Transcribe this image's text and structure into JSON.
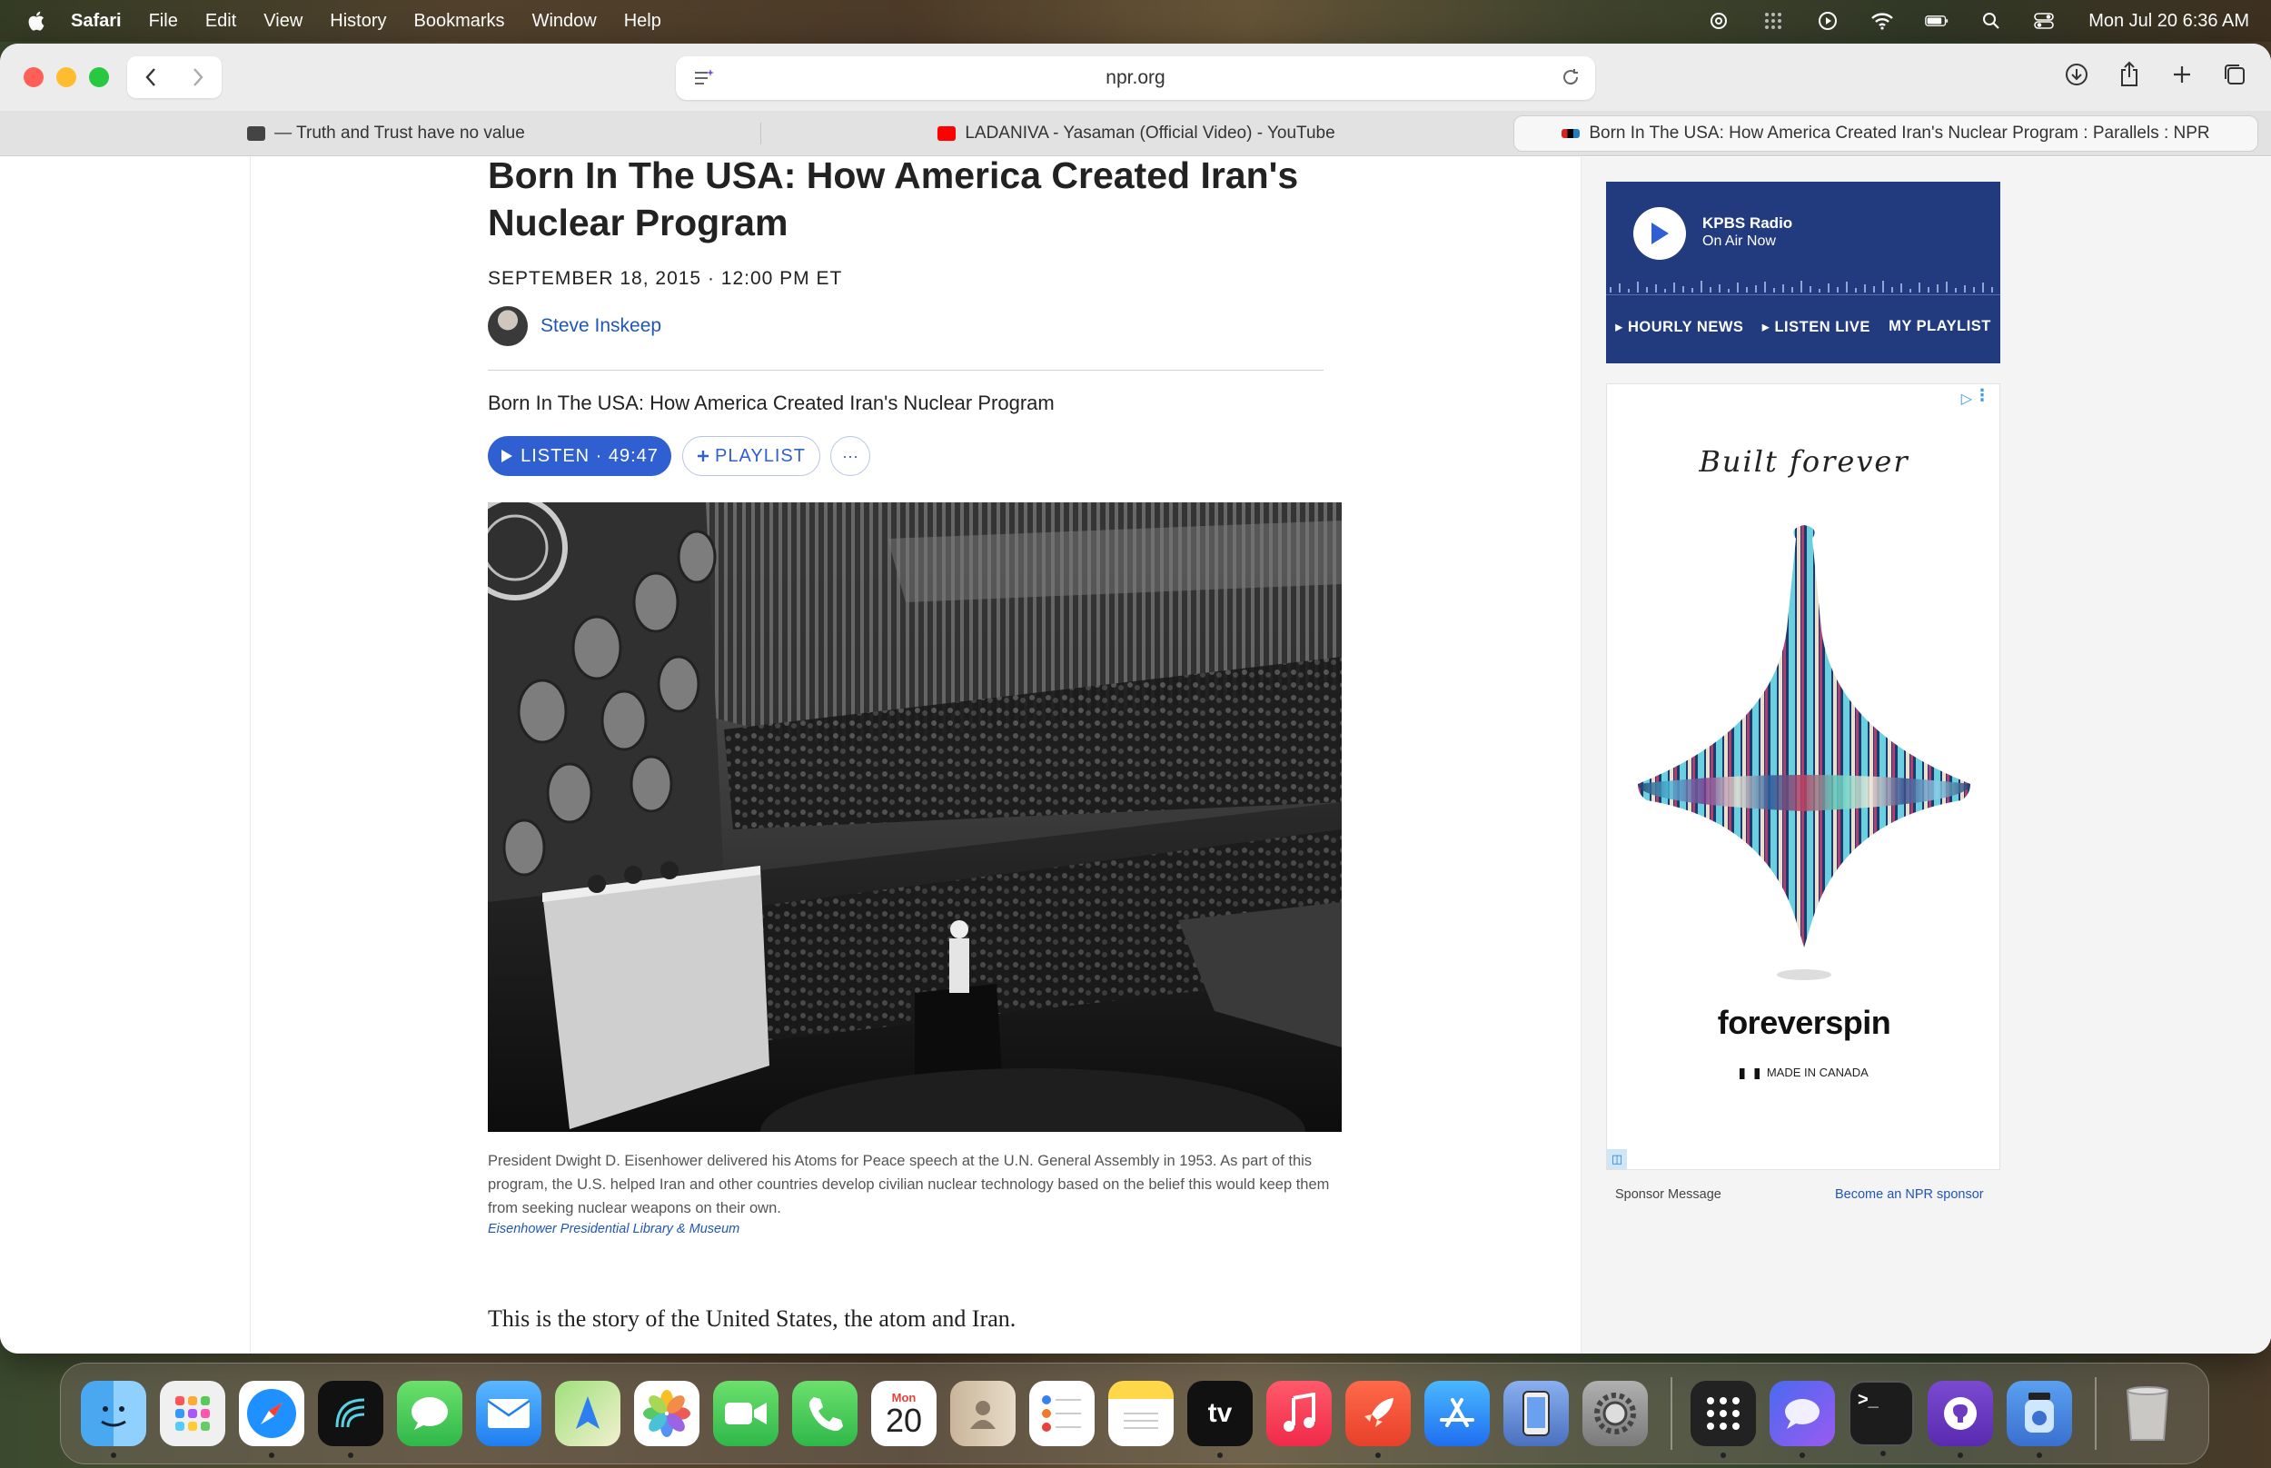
{
  "menubar": {
    "app": "Safari",
    "items": [
      "File",
      "Edit",
      "View",
      "History",
      "Bookmarks",
      "Window",
      "Help"
    ],
    "datetime": "Mon Jul 20  6:36 AM"
  },
  "browser": {
    "url": "npr.org",
    "tabs": [
      {
        "label": "— Truth and Trust have no value"
      },
      {
        "label": "LADANIVA - Yasaman (Official Video) - YouTube"
      },
      {
        "label": "Born In The USA: How America Created Iran's Nuclear Program : Parallels : NPR"
      }
    ]
  },
  "article": {
    "title": "Born In The USA: How America Created Iran's Nuclear Program",
    "date": "SEPTEMBER 18, 2015 · 12:00 PM ET",
    "author": "Steve Inskeep",
    "audio_title": "Born In The USA: How America Created Iran's Nuclear Program",
    "listen_label": "LISTEN · 49:47",
    "playlist_label": "PLAYLIST",
    "more_label": "···",
    "caption": "President Dwight D. Eisenhower delivered his Atoms for Peace speech at the U.N. General Assembly in 1953. As part of this program, the U.S. helped Iran and other countries develop civilian nuclear technology based on the belief this would keep them from seeking nuclear weapons on their own.",
    "credit": "Eisenhower Presidential Library & Museum",
    "body_first": "This is the story of the United States, the atom and Iran."
  },
  "radio": {
    "station": "KPBS Radio",
    "status": "On Air Now",
    "links": [
      "▸ HOURLY NEWS",
      "▸ LISTEN LIVE",
      "MY PLAYLIST"
    ]
  },
  "ad": {
    "tagline": "Built forever",
    "brand": "foreverspin",
    "made": "MADE IN CANADA",
    "sponsor_label": "Sponsor Message",
    "become_label": "Become an NPR sponsor"
  },
  "dock": {
    "calendar_month": "Mon",
    "calendar_day": "20",
    "apps": [
      "finder",
      "launchpad",
      "safari",
      "app-4",
      "messages",
      "mail",
      "maps",
      "photos",
      "facetime",
      "phone",
      "calendar",
      "contacts",
      "reminders",
      "notes",
      "tv",
      "music",
      "rocket",
      "app-store",
      "simulator",
      "system-settings",
      "app-grid",
      "app-chat",
      "terminal",
      "github",
      "app-jar",
      "trash"
    ]
  }
}
